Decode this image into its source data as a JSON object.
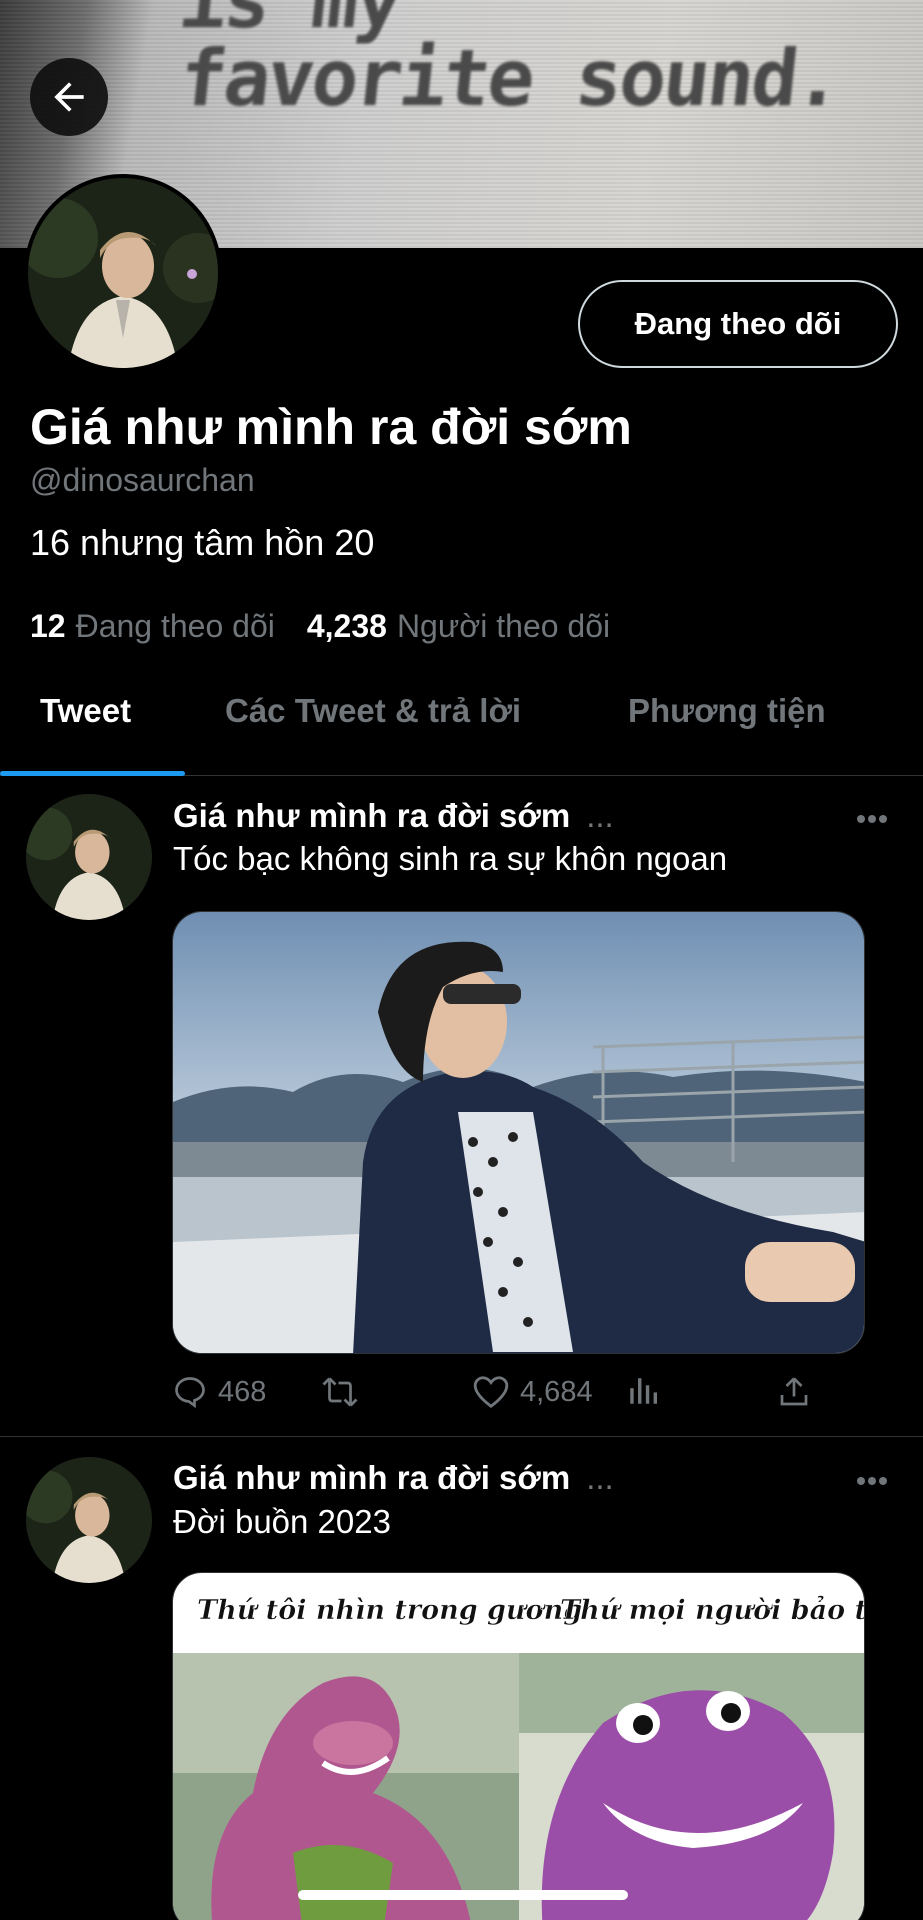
{
  "banner": {
    "line1": "is my",
    "line2": "favorite sound."
  },
  "profile": {
    "display_name": "Giá như mình ra đời sớm",
    "handle": "@dinosaurchan",
    "bio": "16 nhưng tâm hồn 20",
    "following_count": "12",
    "following_label": "Đang theo dõi",
    "followers_count": "4,238",
    "followers_label": "Người theo dõi",
    "follow_button_label": "Đang theo dõi"
  },
  "tabs": [
    {
      "label": "Tweet",
      "active": true
    },
    {
      "label": "Các Tweet & trả lời",
      "active": false
    },
    {
      "label": "Phương tiện",
      "active": false
    }
  ],
  "tweets": [
    {
      "author": "Giá như mình ra đời sớm",
      "ellipsis": "...",
      "text": "Tóc bạc không sinh ra sự khôn ngoan",
      "replies": "468",
      "likes": "4,684"
    },
    {
      "author": "Giá như mình ra đời sớm",
      "ellipsis": "...",
      "text": "Đời buồn 2023",
      "meme_left": "Thứ tôi nhìn trong gương",
      "meme_right": "Thứ mọi người bảo tôi"
    }
  ],
  "icons": {
    "back": "arrow-left-icon",
    "more": "more-horizontal-icon",
    "reply": "comment-icon",
    "retweet": "retweet-icon",
    "like": "heart-icon",
    "views": "analytics-icon",
    "share": "share-icon"
  },
  "colors": {
    "accent": "#1d9bf0",
    "background": "#000000",
    "muted": "#71767b"
  }
}
